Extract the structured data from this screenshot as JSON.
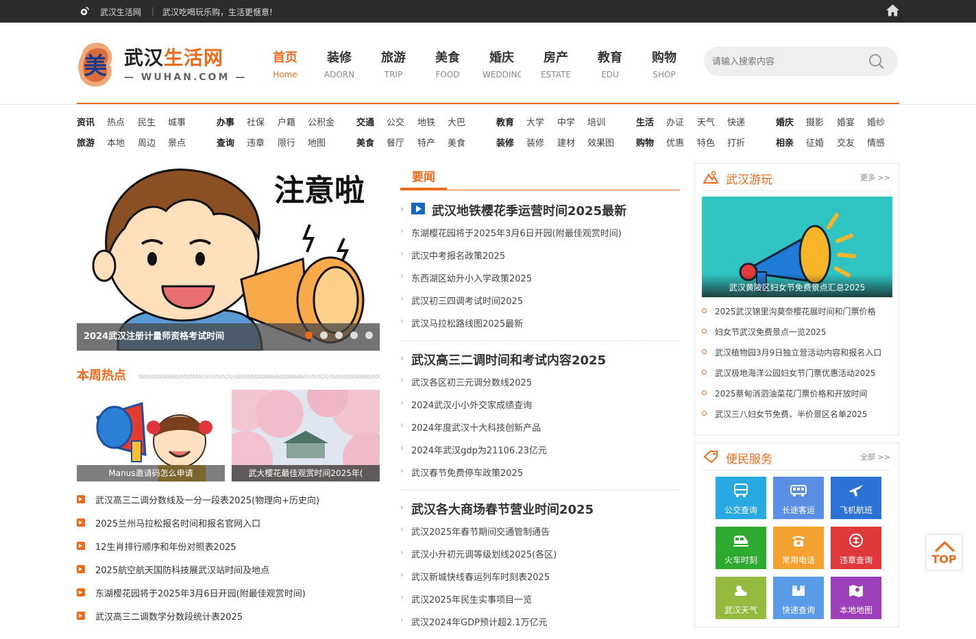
{
  "topbar": {
    "site": "武汉生活网",
    "sep": "|",
    "slogan": "武汉吃喝玩乐购，生活更惬意!"
  },
  "logo": {
    "cn_a": "武汉",
    "cn_b": "生活网",
    "en": "— WUHAN.COM —",
    "mark": "美"
  },
  "nav": [
    {
      "cn": "首页",
      "en": "Home",
      "active": true
    },
    {
      "cn": "装修",
      "en": "ADORN"
    },
    {
      "cn": "旅游",
      "en": "TRIP"
    },
    {
      "cn": "美食",
      "en": "FOOD"
    },
    {
      "cn": "婚庆",
      "en": "WEDDING"
    },
    {
      "cn": "房产",
      "en": "ESTATE"
    },
    {
      "cn": "教育",
      "en": "EDU"
    },
    {
      "cn": "购物",
      "en": "SHOP"
    }
  ],
  "search": {
    "placeholder": "请输入搜索内容"
  },
  "links": [
    {
      "r1": [
        "资讯",
        "热点",
        "民生",
        "城事"
      ],
      "r2": [
        "旅游",
        "本地",
        "周边",
        "景点"
      ]
    },
    {
      "r1": [
        "办事",
        "社保",
        "户籍",
        "公积金"
      ],
      "r2": [
        "查询",
        "违章",
        "限行",
        "地图"
      ]
    },
    {
      "r1": [
        "交通",
        "公交",
        "地铁",
        "大巴"
      ],
      "r2": [
        "美食",
        "餐厅",
        "特产",
        "美食"
      ]
    },
    {
      "r1": [
        "教育",
        "大学",
        "中学",
        "培训"
      ],
      "r2": [
        "装修",
        "装修",
        "建材",
        "效果图"
      ]
    },
    {
      "r1": [
        "生活",
        "办证",
        "天气",
        "快递"
      ],
      "r2": [
        "购物",
        "优惠",
        "特色",
        "打折"
      ]
    },
    {
      "r1": [
        "婚庆",
        "摄影",
        "婚宴",
        "婚纱"
      ],
      "r2": [
        "相亲",
        "征婚",
        "交友",
        "情感"
      ]
    }
  ],
  "slider": {
    "text": "注意啦",
    "caption": "2024武汉注册计量师资格考试时间",
    "dots": 5,
    "active": 0
  },
  "hot": {
    "title": "本周热点",
    "pics": [
      {
        "caption": "Manus邀请码怎么申请"
      },
      {
        "caption": "武大樱花最佳观赏时间2025年("
      }
    ],
    "items": [
      "武汉高三二调分数线及一分一段表2025(物理向+历史向)",
      "2025兰州马拉松报名时间和报名官网入口",
      "12生肖排行顺序和年份对照表2025",
      "2025航空航天国防科技展武汉站时间及地点",
      "东湖樱花园将于2025年3月6日开园(附最佳观赏时间)",
      "武汉高三二调数学分数段统计表2025"
    ]
  },
  "news": {
    "tab": "要闻",
    "blocks": [
      {
        "headline": "武汉地铁樱花季运营时间2025最新",
        "items": [
          "东湖樱花园将于2025年3月6日开园(附最佳观赏时间)",
          "武汉中考报名政策2025",
          "东西湖区幼升小入学政策2025",
          "武汉初三四调考试时间2025",
          "武汉马拉松路线图2025最新"
        ]
      },
      {
        "headline": "武汉高三二调时间和考试内容2025",
        "items": [
          "武汉各区初三元调分数线2025",
          "2024武汉小小外交家成绩查询",
          "2024年度武汉十大科技创新产品",
          "2024年武汉gdp为21106.23亿元",
          "武汉春节免费停车政策2025"
        ]
      },
      {
        "headline": "武汉各大商场春节营业时间2025",
        "items": [
          "武汉2025年春节期间交通管制通告",
          "武汉小升初元调等级划线2025(各区)",
          "武汉新城快线春运列车时刻表2025",
          "武汉2025年民生实事项目一览",
          "武汉2024年GDP预计超2.1万亿元"
        ]
      }
    ]
  },
  "trip": {
    "title": "武汉游玩",
    "more": "更多 >>",
    "pic_caption": "武汉黄陂区妇女节免费景点汇总2025",
    "items": [
      "2025武汉锦里沟莫奈樱花展时间和门票价格",
      "妇女节武汉免费景点一览2025",
      "武汉植物园3月9日独立营活动内容和报名入口",
      "武汉极地海洋公园妇女节门票优惠活动2025",
      "2025蔡甸消泗油菜花门票价格和开放时间",
      "武汉三八妇女节免费、半价景区名单2025"
    ]
  },
  "services": {
    "title": "便民服务",
    "more": "全部 >>",
    "items": [
      {
        "label": "公交查询",
        "color": "#29a9e1",
        "icon": "bus-icon"
      },
      {
        "label": "长途客运",
        "color": "#5b8fe6",
        "icon": "coach-icon"
      },
      {
        "label": "飞机航班",
        "color": "#2d73d6",
        "icon": "plane-icon"
      },
      {
        "label": "火车时刻",
        "color": "#2eaa2e",
        "icon": "train-icon"
      },
      {
        "label": "常用电话",
        "color": "#f4a131",
        "icon": "phone-icon"
      },
      {
        "label": "违章查询",
        "color": "#e0393b",
        "icon": "violation-icon"
      },
      {
        "label": "武汉天气",
        "color": "#93bb3d",
        "icon": "weather-icon"
      },
      {
        "label": "快递查询",
        "color": "#5a9be8",
        "icon": "box-icon"
      },
      {
        "label": "本地地图",
        "color": "#9c3fb8",
        "icon": "map-icon"
      }
    ]
  },
  "totop": {
    "label": "TOP"
  }
}
